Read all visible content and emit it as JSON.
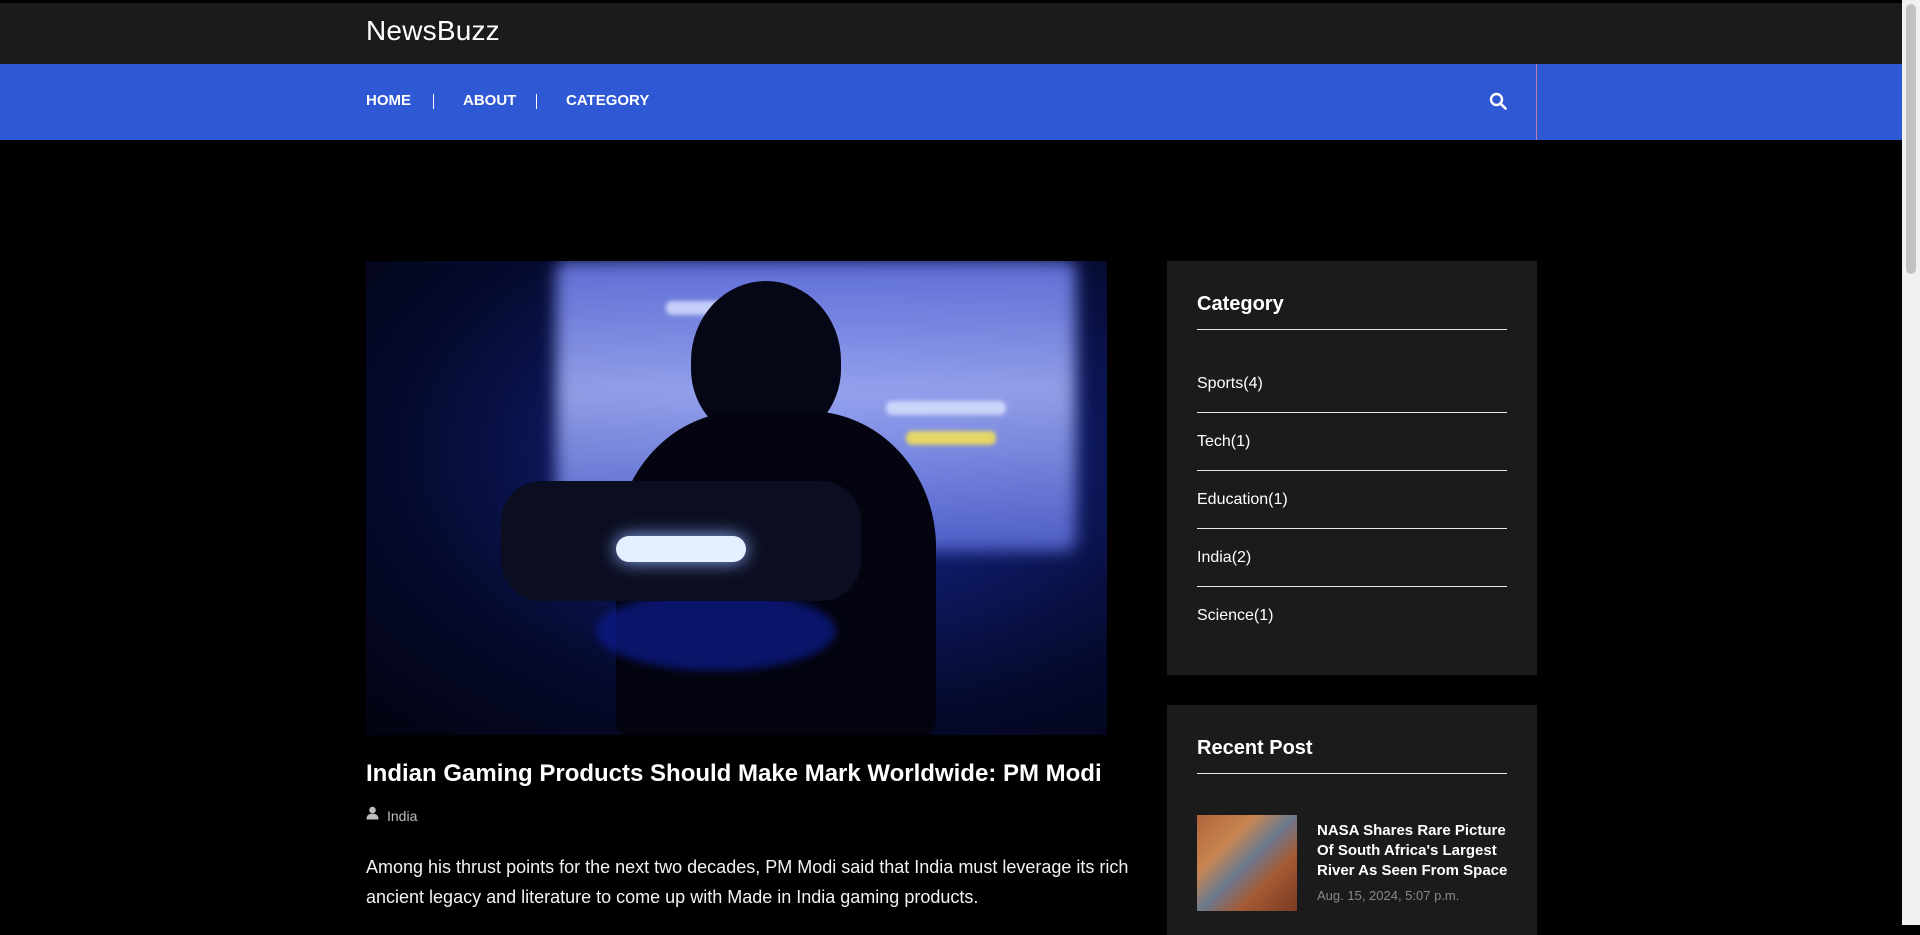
{
  "header": {
    "brand": "NewsBuzz"
  },
  "nav": {
    "items": [
      "HOME",
      "ABOUT",
      "CATEGORY"
    ],
    "search_icon": "search-icon"
  },
  "post": {
    "title": "Indian Gaming Products Should Make Mark Worldwide: PM Modi",
    "category": "India",
    "excerpt": "Among his thrust points for the next two decades, PM Modi said that India must leverage its rich ancient legacy and literature to come up with Made in India gaming products."
  },
  "sidebar": {
    "category": {
      "title": "Category",
      "items": [
        "Sports(4)",
        "Tech(1)",
        "Education(1)",
        "India(2)",
        "Science(1)"
      ]
    },
    "recent": {
      "title": "Recent Post",
      "items": [
        {
          "title": "NASA Shares Rare Picture Of South Africa's Largest River As Seen From Space",
          "date": "Aug. 15, 2024, 5:07 p.m."
        }
      ]
    }
  },
  "colors": {
    "topbar": "#1b1b1b",
    "navbar": "#2f58d4",
    "widget": "#1b1b1b",
    "background": "#000000"
  }
}
